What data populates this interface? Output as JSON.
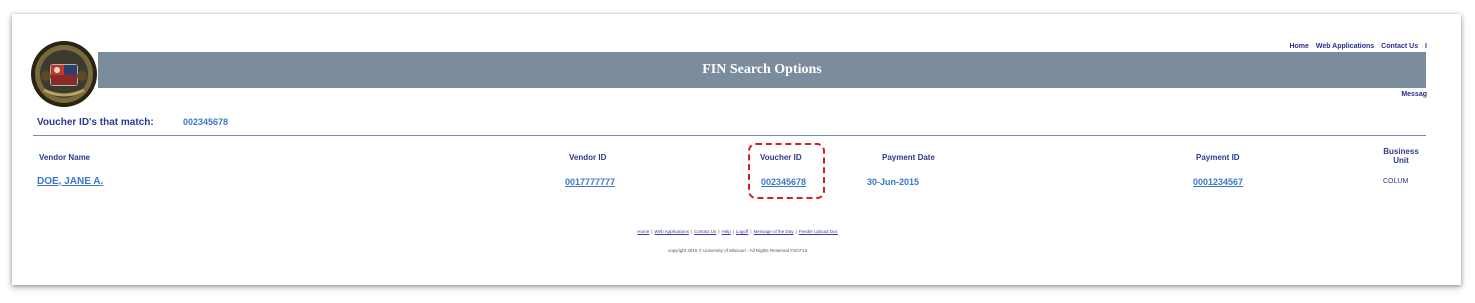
{
  "header": {
    "title": "FIN Search Options",
    "top_links": [
      "Home",
      "Web Applications",
      "Contact Us",
      "I"
    ],
    "message_link": "Messag"
  },
  "search": {
    "match_label": "Voucher ID's that match:",
    "match_value": "002345678"
  },
  "table": {
    "columns": {
      "vendor_name": "Vendor Name",
      "vendor_id": "Vendor ID",
      "voucher_id": "Voucher ID",
      "payment_date": "Payment Date",
      "payment_id": "Payment ID",
      "business_unit_line1": "Business",
      "business_unit_line2": "Unit"
    },
    "rows": [
      {
        "vendor_name": "DOE, JANE A.",
        "vendor_id": "0017777777",
        "voucher_id": "002345678",
        "payment_date": "30-Jun-2015",
        "payment_id": "0001234567",
        "business_unit": "COLUM"
      }
    ]
  },
  "footer": {
    "links": [
      "Home",
      "Web Applications",
      "Contact Us",
      "Help",
      "Logoff",
      "Message of the Day",
      "Feeder Upload Doc"
    ],
    "copyright": "copyright 2015 © University of Missouri - All Rights Reserved    FSCF13"
  },
  "colors": {
    "header_bar": "#7b8c9c",
    "link": "#3b78c8",
    "heading": "#2b3b8c",
    "highlight": "#d31f1f"
  }
}
